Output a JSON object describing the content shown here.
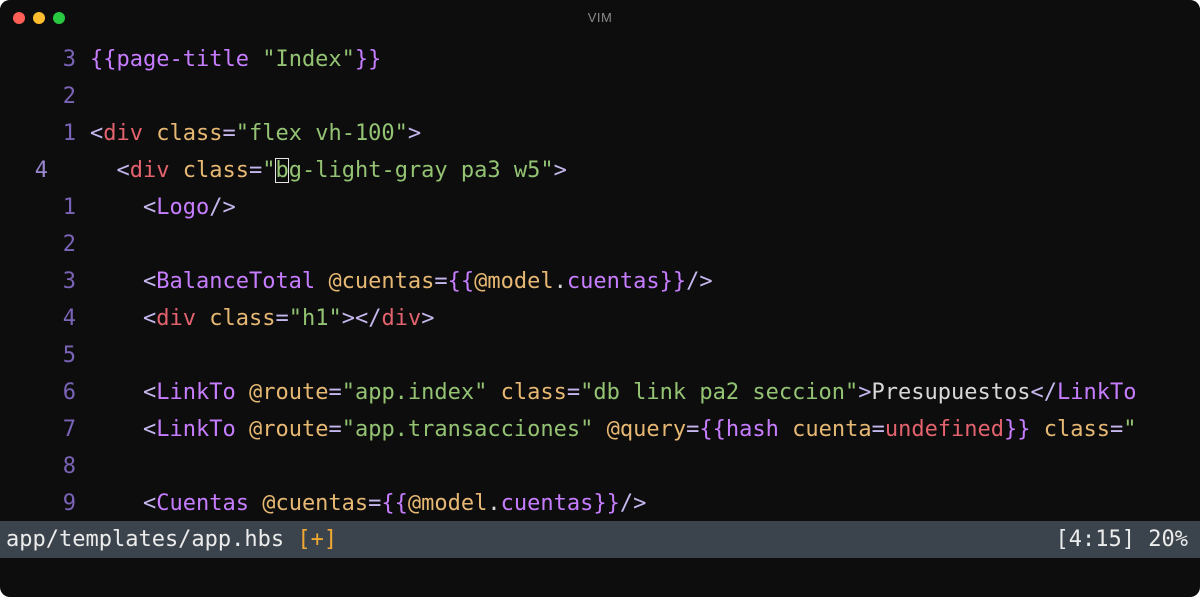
{
  "window": {
    "title": "VIM"
  },
  "editor": {
    "lines": [
      {
        "number": "3",
        "current": false,
        "tokens": [
          {
            "text": "{{",
            "cls": "c-brace"
          },
          {
            "text": "page-title",
            "cls": "c-helper"
          },
          {
            "text": " ",
            "cls": "c-text"
          },
          {
            "text": "\"Index\"",
            "cls": "c-str"
          },
          {
            "text": "}}",
            "cls": "c-brace"
          }
        ]
      },
      {
        "number": "2",
        "current": false,
        "tokens": []
      },
      {
        "number": "1",
        "current": false,
        "tokens": [
          {
            "text": "<",
            "cls": "c-punct"
          },
          {
            "text": "div",
            "cls": "c-tag"
          },
          {
            "text": " ",
            "cls": "c-text"
          },
          {
            "text": "class",
            "cls": "c-attr"
          },
          {
            "text": "=",
            "cls": "c-punct"
          },
          {
            "text": "\"flex vh-100\"",
            "cls": "c-str"
          },
          {
            "text": ">",
            "cls": "c-punct"
          }
        ]
      },
      {
        "number": "4",
        "current": true,
        "tokens": [
          {
            "text": "  ",
            "cls": "c-text"
          },
          {
            "text": "<",
            "cls": "c-punct"
          },
          {
            "text": "div",
            "cls": "c-tag"
          },
          {
            "text": " ",
            "cls": "c-text"
          },
          {
            "text": "class",
            "cls": "c-attr"
          },
          {
            "text": "=",
            "cls": "c-punct"
          },
          {
            "text": "\"",
            "cls": "c-str"
          },
          {
            "text": "b",
            "cls": "c-str cursor"
          },
          {
            "text": "g-light-gray pa3 w5\"",
            "cls": "c-str"
          },
          {
            "text": ">",
            "cls": "c-punct"
          }
        ]
      },
      {
        "number": "1",
        "current": false,
        "tokens": [
          {
            "text": "    ",
            "cls": "c-text"
          },
          {
            "text": "<",
            "cls": "c-punct"
          },
          {
            "text": "Logo",
            "cls": "c-comp"
          },
          {
            "text": "/>",
            "cls": "c-punct"
          }
        ]
      },
      {
        "number": "2",
        "current": false,
        "tokens": []
      },
      {
        "number": "3",
        "current": false,
        "tokens": [
          {
            "text": "    ",
            "cls": "c-text"
          },
          {
            "text": "<",
            "cls": "c-punct"
          },
          {
            "text": "BalanceTotal",
            "cls": "c-comp"
          },
          {
            "text": " ",
            "cls": "c-text"
          },
          {
            "text": "@cuentas",
            "cls": "c-attr"
          },
          {
            "text": "=",
            "cls": "c-punct"
          },
          {
            "text": "{{",
            "cls": "c-brace"
          },
          {
            "text": "@model",
            "cls": "c-attr"
          },
          {
            "text": ".",
            "cls": "c-text"
          },
          {
            "text": "cuentas",
            "cls": "c-helper"
          },
          {
            "text": "}}",
            "cls": "c-brace"
          },
          {
            "text": "/>",
            "cls": "c-punct"
          }
        ]
      },
      {
        "number": "4",
        "current": false,
        "tokens": [
          {
            "text": "    ",
            "cls": "c-text"
          },
          {
            "text": "<",
            "cls": "c-punct"
          },
          {
            "text": "div",
            "cls": "c-tag"
          },
          {
            "text": " ",
            "cls": "c-text"
          },
          {
            "text": "class",
            "cls": "c-attr"
          },
          {
            "text": "=",
            "cls": "c-punct"
          },
          {
            "text": "\"h1\"",
            "cls": "c-str"
          },
          {
            "text": "></",
            "cls": "c-punct"
          },
          {
            "text": "div",
            "cls": "c-tag"
          },
          {
            "text": ">",
            "cls": "c-punct"
          }
        ]
      },
      {
        "number": "5",
        "current": false,
        "tokens": []
      },
      {
        "number": "6",
        "current": false,
        "tokens": [
          {
            "text": "    ",
            "cls": "c-text"
          },
          {
            "text": "<",
            "cls": "c-punct"
          },
          {
            "text": "LinkTo",
            "cls": "c-comp"
          },
          {
            "text": " ",
            "cls": "c-text"
          },
          {
            "text": "@route",
            "cls": "c-attr"
          },
          {
            "text": "=",
            "cls": "c-punct"
          },
          {
            "text": "\"app.index\"",
            "cls": "c-str"
          },
          {
            "text": " ",
            "cls": "c-text"
          },
          {
            "text": "class",
            "cls": "c-attr"
          },
          {
            "text": "=",
            "cls": "c-punct"
          },
          {
            "text": "\"db link pa2 seccion\"",
            "cls": "c-str"
          },
          {
            "text": ">",
            "cls": "c-punct"
          },
          {
            "text": "Presupuestos",
            "cls": "c-text"
          },
          {
            "text": "</",
            "cls": "c-punct"
          },
          {
            "text": "LinkTo",
            "cls": "c-comp"
          }
        ]
      },
      {
        "number": "7",
        "current": false,
        "tokens": [
          {
            "text": "    ",
            "cls": "c-text"
          },
          {
            "text": "<",
            "cls": "c-punct"
          },
          {
            "text": "LinkTo",
            "cls": "c-comp"
          },
          {
            "text": " ",
            "cls": "c-text"
          },
          {
            "text": "@route",
            "cls": "c-attr"
          },
          {
            "text": "=",
            "cls": "c-punct"
          },
          {
            "text": "\"app.transacciones\"",
            "cls": "c-str"
          },
          {
            "text": " ",
            "cls": "c-text"
          },
          {
            "text": "@query",
            "cls": "c-attr"
          },
          {
            "text": "=",
            "cls": "c-punct"
          },
          {
            "text": "{{",
            "cls": "c-brace"
          },
          {
            "text": "hash",
            "cls": "c-helper"
          },
          {
            "text": " ",
            "cls": "c-text"
          },
          {
            "text": "cuenta",
            "cls": "c-attr"
          },
          {
            "text": "=",
            "cls": "c-punct"
          },
          {
            "text": "undefined",
            "cls": "c-undef"
          },
          {
            "text": "}}",
            "cls": "c-brace"
          },
          {
            "text": " ",
            "cls": "c-text"
          },
          {
            "text": "class",
            "cls": "c-attr"
          },
          {
            "text": "=",
            "cls": "c-punct"
          },
          {
            "text": "\"",
            "cls": "c-str"
          }
        ]
      },
      {
        "number": "8",
        "current": false,
        "tokens": []
      },
      {
        "number": "9",
        "current": false,
        "tokens": [
          {
            "text": "    ",
            "cls": "c-text"
          },
          {
            "text": "<",
            "cls": "c-punct"
          },
          {
            "text": "Cuentas",
            "cls": "c-comp"
          },
          {
            "text": " ",
            "cls": "c-text"
          },
          {
            "text": "@cuentas",
            "cls": "c-attr"
          },
          {
            "text": "=",
            "cls": "c-punct"
          },
          {
            "text": "{{",
            "cls": "c-brace"
          },
          {
            "text": "@model",
            "cls": "c-attr"
          },
          {
            "text": ".",
            "cls": "c-text"
          },
          {
            "text": "cuentas",
            "cls": "c-helper"
          },
          {
            "text": "}}",
            "cls": "c-brace"
          },
          {
            "text": "/>",
            "cls": "c-punct"
          }
        ]
      }
    ]
  },
  "statusline": {
    "file_path": "app/templates/app.hbs",
    "modified_flag": "[+]",
    "position": "[4:15]",
    "percent": "20%"
  },
  "colors": {
    "background": "#0d0d0d",
    "line_number": "#7b63b8",
    "statusline_bg": "#3b434d",
    "modified": "#f0a830"
  }
}
